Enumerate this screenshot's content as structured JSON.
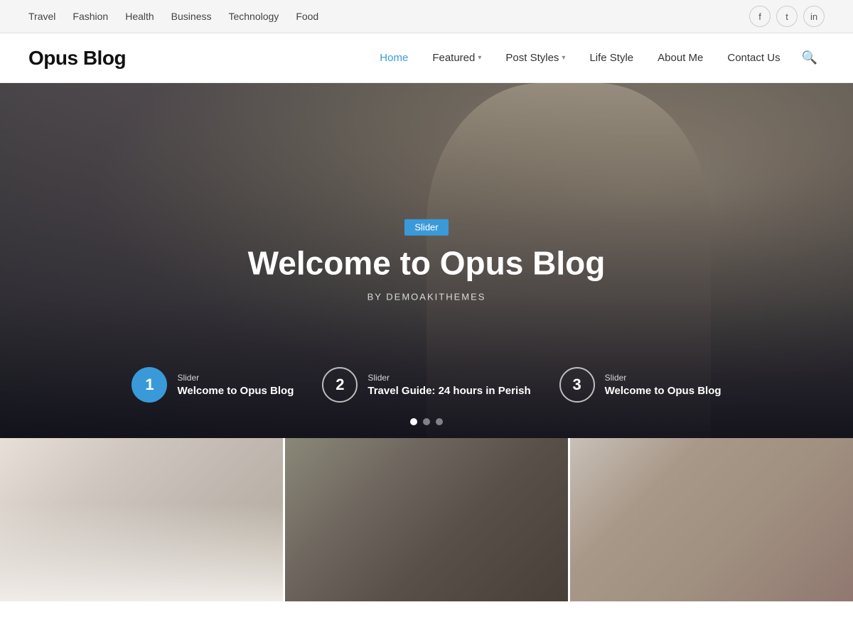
{
  "topbar": {
    "links": [
      {
        "label": "Travel",
        "href": "#"
      },
      {
        "label": "Fashion",
        "href": "#"
      },
      {
        "label": "Health",
        "href": "#"
      },
      {
        "label": "Business",
        "href": "#"
      },
      {
        "label": "Technology",
        "href": "#"
      },
      {
        "label": "Food",
        "href": "#"
      }
    ],
    "social": [
      {
        "icon": "f",
        "name": "facebook"
      },
      {
        "icon": "t",
        "name": "twitter"
      },
      {
        "icon": "in",
        "name": "linkedin"
      }
    ]
  },
  "header": {
    "logo": "Opus Blog",
    "nav": [
      {
        "label": "Home",
        "active": true,
        "hasDropdown": false
      },
      {
        "label": "Featured",
        "active": false,
        "hasDropdown": true
      },
      {
        "label": "Post Styles",
        "active": false,
        "hasDropdown": true
      },
      {
        "label": "Life Style",
        "active": false,
        "hasDropdown": false
      },
      {
        "label": "About Me",
        "active": false,
        "hasDropdown": false
      },
      {
        "label": "Contact Us",
        "active": false,
        "hasDropdown": false
      }
    ]
  },
  "hero": {
    "tag": "Slider",
    "title": "Welcome to Opus Blog",
    "author": "BY DEMOAKITHEMES"
  },
  "slider_thumbs": [
    {
      "number": "1",
      "active": true,
      "tag": "Slider",
      "title": "Welcome to Opus Blog"
    },
    {
      "number": "2",
      "active": false,
      "tag": "Slider",
      "title": "Travel Guide: 24 hours in Perish"
    },
    {
      "number": "3",
      "active": false,
      "tag": "Slider",
      "title": "Welcome to Opus Blog"
    }
  ],
  "slider_dots": [
    {
      "active": true
    },
    {
      "active": false
    },
    {
      "active": false
    }
  ],
  "post_cards": [
    {
      "id": "card1",
      "img_class": "desk"
    },
    {
      "id": "card2",
      "img_class": "family"
    },
    {
      "id": "card3",
      "img_class": "portrait"
    }
  ]
}
